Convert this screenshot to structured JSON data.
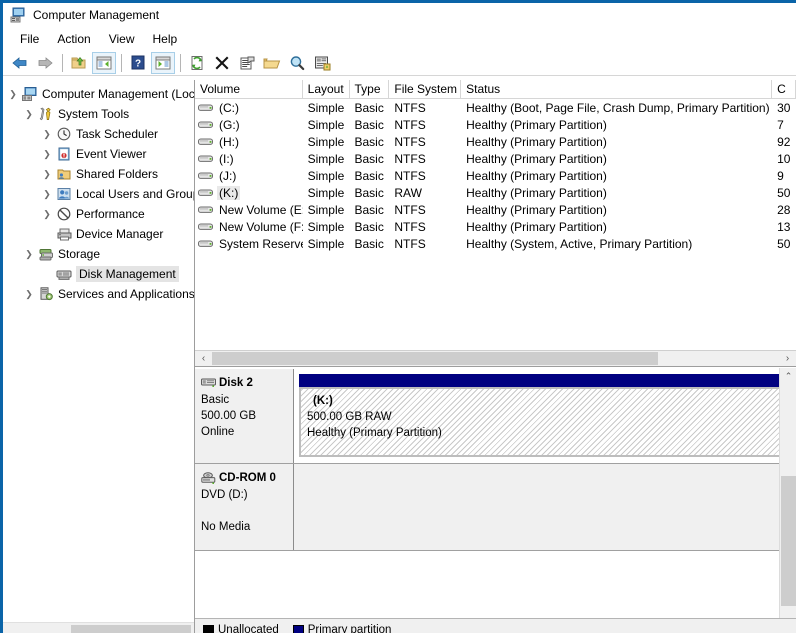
{
  "window": {
    "title": "Computer Management",
    "title_icon": "computer-management-icon"
  },
  "menu": {
    "items": [
      {
        "label": "File"
      },
      {
        "label": "Action"
      },
      {
        "label": "View"
      },
      {
        "label": "Help"
      }
    ]
  },
  "toolbar": {
    "buttons": [
      {
        "name": "back-icon",
        "tip": "Back"
      },
      {
        "name": "forward-icon",
        "tip": "Forward"
      },
      {
        "name": "up-one-level-icon",
        "tip": "Up One Level"
      },
      {
        "name": "show-hide-console-tree-icon",
        "tip": "Show/Hide Console Tree"
      },
      {
        "name": "help-icon",
        "tip": "Help"
      },
      {
        "name": "show-hide-action-pane-icon",
        "tip": "Show/Hide Action Pane"
      },
      {
        "name": "refresh-icon",
        "tip": "Refresh"
      },
      {
        "name": "delete-icon",
        "tip": "Delete"
      },
      {
        "name": "properties-icon",
        "tip": "Properties"
      },
      {
        "name": "open-folder-icon",
        "tip": "Open"
      },
      {
        "name": "find-icon",
        "tip": "Find"
      },
      {
        "name": "rescan-disks-icon",
        "tip": "Rescan Disks"
      }
    ]
  },
  "tree": {
    "root": {
      "label": "Computer Management (Local",
      "icon": "computer-icon",
      "twist": "expanded"
    },
    "items": [
      {
        "label": "System Tools",
        "icon": "system-tools-icon",
        "twist": "expanded",
        "indent": 1
      },
      {
        "label": "Task Scheduler",
        "icon": "task-scheduler-icon",
        "twist": "collapsed",
        "indent": 2
      },
      {
        "label": "Event Viewer",
        "icon": "event-viewer-icon",
        "twist": "collapsed",
        "indent": 2
      },
      {
        "label": "Shared Folders",
        "icon": "shared-folders-icon",
        "twist": "collapsed",
        "indent": 2
      },
      {
        "label": "Local Users and Groups",
        "icon": "local-users-icon",
        "twist": "collapsed",
        "indent": 2
      },
      {
        "label": "Performance",
        "icon": "performance-icon",
        "twist": "collapsed",
        "indent": 2
      },
      {
        "label": "Device Manager",
        "icon": "device-manager-icon",
        "twist": "none",
        "indent": 2
      },
      {
        "label": "Storage",
        "icon": "storage-icon",
        "twist": "expanded",
        "indent": 1
      },
      {
        "label": "Disk Management",
        "icon": "disk-management-icon",
        "twist": "none",
        "indent": 2,
        "selected": true
      },
      {
        "label": "Services and Applications",
        "icon": "services-icon",
        "twist": "collapsed",
        "indent": 1
      }
    ]
  },
  "volume_list": {
    "columns": [
      {
        "label": "Volume",
        "key": "volume"
      },
      {
        "label": "Layout",
        "key": "layout"
      },
      {
        "label": "Type",
        "key": "type"
      },
      {
        "label": "File System",
        "key": "filesystem"
      },
      {
        "label": "Status",
        "key": "status"
      },
      {
        "label": "C",
        "key": "capacity"
      }
    ],
    "rows": [
      {
        "volume": "(C:)",
        "layout": "Simple",
        "type": "Basic",
        "filesystem": "NTFS",
        "status": "Healthy (Boot, Page File, Crash Dump, Primary Partition)",
        "capacity": "30",
        "selected": false
      },
      {
        "volume": "(G:)",
        "layout": "Simple",
        "type": "Basic",
        "filesystem": "NTFS",
        "status": "Healthy (Primary Partition)",
        "capacity": "7",
        "selected": false
      },
      {
        "volume": "(H:)",
        "layout": "Simple",
        "type": "Basic",
        "filesystem": "NTFS",
        "status": "Healthy (Primary Partition)",
        "capacity": "92",
        "selected": false
      },
      {
        "volume": "(I:)",
        "layout": "Simple",
        "type": "Basic",
        "filesystem": "NTFS",
        "status": "Healthy (Primary Partition)",
        "capacity": "10",
        "selected": false
      },
      {
        "volume": "(J:)",
        "layout": "Simple",
        "type": "Basic",
        "filesystem": "NTFS",
        "status": "Healthy (Primary Partition)",
        "capacity": "9",
        "selected": false
      },
      {
        "volume": "(K:)",
        "layout": "Simple",
        "type": "Basic",
        "filesystem": "RAW",
        "status": "Healthy (Primary Partition)",
        "capacity": "50",
        "selected": true
      },
      {
        "volume": "New Volume (E:)",
        "layout": "Simple",
        "type": "Basic",
        "filesystem": "NTFS",
        "status": "Healthy (Primary Partition)",
        "capacity": "28",
        "selected": false
      },
      {
        "volume": "New Volume (F:)",
        "layout": "Simple",
        "type": "Basic",
        "filesystem": "NTFS",
        "status": "Healthy (Primary Partition)",
        "capacity": "13",
        "selected": false
      },
      {
        "volume": "System Reserved",
        "layout": "Simple",
        "type": "Basic",
        "filesystem": "NTFS",
        "status": "Healthy (System, Active, Primary Partition)",
        "capacity": "50",
        "selected": false
      }
    ]
  },
  "disk_view": {
    "disks": [
      {
        "name": "Disk 2",
        "type": "Basic",
        "size": "500.00 GB",
        "state": "Online",
        "icon": "disk-icon",
        "partition": {
          "name": "(K:)",
          "size_fs": "500.00 GB RAW",
          "status": "Healthy (Primary Partition)",
          "header_color": "#000080",
          "fill": "hatched"
        }
      },
      {
        "name": "CD-ROM 0",
        "type": "DVD (D:)",
        "size": "",
        "state": "No Media",
        "icon": "cdrom-icon",
        "partition": null
      }
    ]
  },
  "legend": {
    "items": [
      {
        "label": "Unallocated",
        "color": "#000000"
      },
      {
        "label": "Primary partition",
        "color": "#000080"
      }
    ]
  },
  "scrollbars": {
    "vol_h_left_arrow": "‹",
    "vol_h_right_arrow": "›",
    "disk_v_up_arrow": "⌃",
    "disk_v_down_arrow": "⌄"
  }
}
